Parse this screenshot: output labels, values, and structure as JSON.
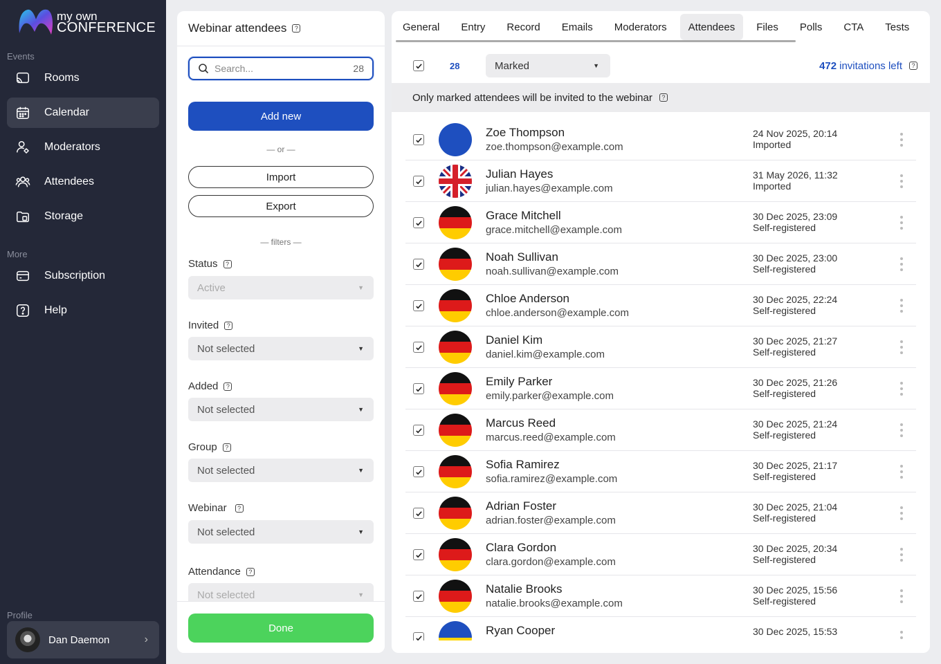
{
  "app": {
    "logo_line1": "my own",
    "logo_line2": "CONFERENCE",
    "accent": "#1e4fbf",
    "success": "#4cd35c"
  },
  "sidebar": {
    "events_label": "Events",
    "more_label": "More",
    "profile_label": "Profile",
    "items": [
      {
        "label": "Rooms",
        "icon": "cast-icon"
      },
      {
        "label": "Calendar",
        "icon": "calendar-icon",
        "active": true
      },
      {
        "label": "Moderators",
        "icon": "moderator-icon"
      },
      {
        "label": "Attendees",
        "icon": "users-icon"
      },
      {
        "label": "Storage",
        "icon": "folder-icon"
      }
    ],
    "more_items": [
      {
        "label": "Subscription",
        "icon": "card-icon"
      },
      {
        "label": "Help",
        "icon": "help-icon"
      }
    ],
    "profile_name": "Dan Daemon"
  },
  "mid": {
    "title": "Webinar attendees",
    "search_placeholder": "Search...",
    "search_count": "28",
    "add_new": "Add new",
    "or": "— or —",
    "import": "Import",
    "export": "Export",
    "filters_label": "— filters —",
    "filters": [
      {
        "label": "Status",
        "value": "Active",
        "disabled": true
      },
      {
        "label": "Invited",
        "value": "Not selected"
      },
      {
        "label": "Added",
        "value": "Not selected"
      },
      {
        "label": "Group",
        "value": "Not selected"
      },
      {
        "label": "Webinar",
        "value": "Not selected"
      },
      {
        "label": "Attendance",
        "value": "Not selected",
        "disabled": true
      }
    ],
    "done": "Done"
  },
  "right": {
    "tabs": [
      "General",
      "Entry",
      "Record",
      "Emails",
      "Moderators",
      "Attendees",
      "Files",
      "Polls",
      "CTA",
      "Tests"
    ],
    "active_tab": "Attendees",
    "selected_count": "28",
    "filter_value": "Marked",
    "invites_count": "472",
    "invites_text": "invitations left",
    "notice": "Only marked attendees will be invited to the webinar",
    "attendees": [
      {
        "name": "Zoe Thompson",
        "email": "zoe.thompson@example.com",
        "date": "24 Nov 2025, 20:14",
        "source": "Imported",
        "flag": "blue"
      },
      {
        "name": "Julian Hayes",
        "email": "julian.hayes@example.com",
        "date": "31 May 2026, 11:32",
        "source": "Imported",
        "flag": "uk"
      },
      {
        "name": "Grace Mitchell",
        "email": "grace.mitchell@example.com",
        "date": "30 Dec 2025, 23:09",
        "source": "Self-registered",
        "flag": "de"
      },
      {
        "name": "Noah Sullivan",
        "email": "noah.sullivan@example.com",
        "date": "30 Dec 2025, 23:00",
        "source": "Self-registered",
        "flag": "de"
      },
      {
        "name": "Chloe Anderson",
        "email": "chloe.anderson@example.com",
        "date": "30 Dec 2025, 22:24",
        "source": "Self-registered",
        "flag": "de"
      },
      {
        "name": "Daniel Kim",
        "email": "daniel.kim@example.com",
        "date": "30 Dec 2025, 21:27",
        "source": "Self-registered",
        "flag": "de"
      },
      {
        "name": "Emily Parker",
        "email": "emily.parker@example.com",
        "date": "30 Dec 2025, 21:26",
        "source": "Self-registered",
        "flag": "de"
      },
      {
        "name": "Marcus Reed",
        "email": "marcus.reed@example.com",
        "date": "30 Dec 2025, 21:24",
        "source": "Self-registered",
        "flag": "de"
      },
      {
        "name": "Sofia Ramirez",
        "email": "sofia.ramirez@example.com",
        "date": "30 Dec 2025, 21:17",
        "source": "Self-registered",
        "flag": "de"
      },
      {
        "name": "Adrian Foster",
        "email": "adrian.foster@example.com",
        "date": "30 Dec 2025, 21:04",
        "source": "Self-registered",
        "flag": "de"
      },
      {
        "name": "Clara Gordon",
        "email": "clara.gordon@example.com",
        "date": "30 Dec 2025, 20:34",
        "source": "Self-registered",
        "flag": "de"
      },
      {
        "name": "Natalie Brooks",
        "email": "natalie.brooks@example.com",
        "date": "30 Dec 2025, 15:56",
        "source": "Self-registered",
        "flag": "de"
      },
      {
        "name": "Ryan Cooper",
        "email": "",
        "date": "30 Dec 2025, 15:53",
        "source": "",
        "flag": "ua"
      }
    ]
  }
}
